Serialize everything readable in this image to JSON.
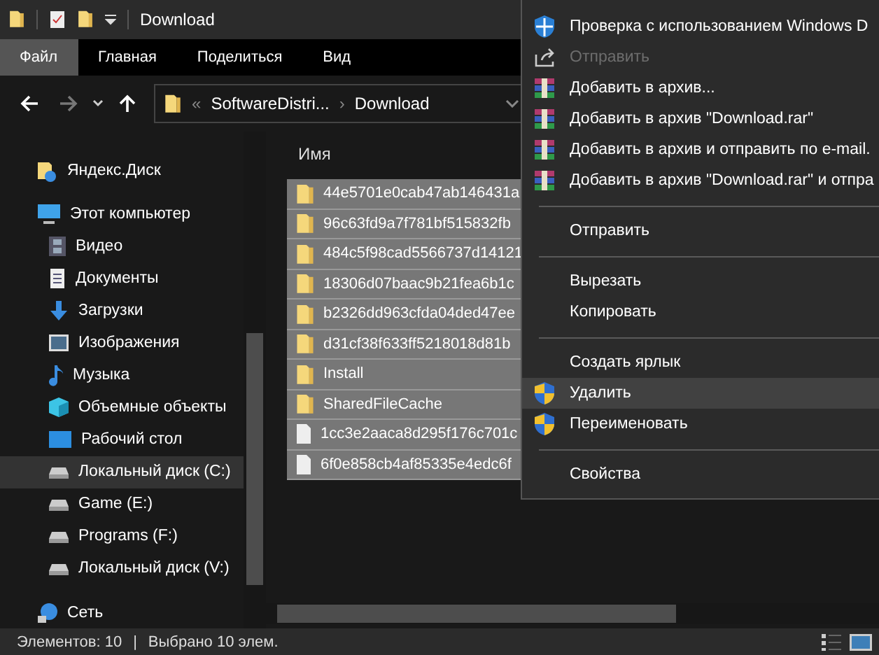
{
  "window": {
    "title": "Download"
  },
  "ribbon_tabs": [
    {
      "label": "Файл",
      "selected": true
    },
    {
      "label": "Главная",
      "selected": false
    },
    {
      "label": "Поделиться",
      "selected": false
    },
    {
      "label": "Вид",
      "selected": false
    }
  ],
  "address": {
    "prefix": "«",
    "crumbs": [
      "SoftwareDistri...",
      "Download"
    ],
    "separator": "›"
  },
  "sidebar": {
    "items": [
      {
        "label": "Яндекс.Диск",
        "kind": "cloud",
        "selected": false
      },
      {
        "label": "Этот компьютер",
        "kind": "computer",
        "selected": false,
        "children": [
          {
            "label": "Видео",
            "kind": "video",
            "selected": false
          },
          {
            "label": "Документы",
            "kind": "docs",
            "selected": false
          },
          {
            "label": "Загрузки",
            "kind": "download",
            "selected": false
          },
          {
            "label": "Изображения",
            "kind": "image",
            "selected": false
          },
          {
            "label": "Музыка",
            "kind": "music",
            "selected": false
          },
          {
            "label": "Объемные объекты",
            "kind": "cube",
            "selected": false
          },
          {
            "label": "Рабочий стол",
            "kind": "desktop",
            "selected": false
          },
          {
            "label": "Локальный диск (C:)",
            "kind": "drive",
            "selected": true
          },
          {
            "label": "Game (E:)",
            "kind": "drive",
            "selected": false
          },
          {
            "label": "Programs (F:)",
            "kind": "drive",
            "selected": false
          },
          {
            "label": "Локальный диск (V:)",
            "kind": "drive",
            "selected": false
          }
        ]
      },
      {
        "label": "Сеть",
        "kind": "network",
        "selected": false
      }
    ]
  },
  "file_list": {
    "column_header": "Имя",
    "rows": [
      {
        "name": "44e5701e0cab47ab146431a",
        "kind": "folder",
        "selected": true
      },
      {
        "name": "96c63fd9a7f781bf515832fb",
        "kind": "folder",
        "selected": true
      },
      {
        "name": "484c5f98cad5566737d14121",
        "kind": "folder",
        "selected": true
      },
      {
        "name": "18306d07baac9b21fea6b1c",
        "kind": "folder",
        "selected": true
      },
      {
        "name": "b2326dd963cfda04ded47ee",
        "kind": "folder",
        "selected": true
      },
      {
        "name": "d31cf38f633ff5218018d81b",
        "kind": "folder",
        "selected": true
      },
      {
        "name": "Install",
        "kind": "folder",
        "selected": true
      },
      {
        "name": "SharedFileCache",
        "kind": "folder",
        "selected": true
      },
      {
        "name": "1cc3e2aaca8d295f176c701c",
        "kind": "file",
        "selected": true
      },
      {
        "name": "6f0e858cb4af85335e4edc6f",
        "kind": "file",
        "selected": true
      }
    ]
  },
  "context_menu": [
    {
      "kind": "shield",
      "label": "Проверка с использованием Windows D",
      "disabled": false,
      "selected": false
    },
    {
      "kind": "share",
      "label": "Отправить",
      "disabled": true,
      "selected": false
    },
    {
      "kind": "archive",
      "label": "Добавить в архив...",
      "disabled": false,
      "selected": false
    },
    {
      "kind": "archive",
      "label": "Добавить в архив \"Download.rar\"",
      "disabled": false,
      "selected": false
    },
    {
      "kind": "archive",
      "label": "Добавить в архив и отправить по e-mail.",
      "disabled": false,
      "selected": false
    },
    {
      "kind": "archive",
      "label": "Добавить в архив \"Download.rar\" и отпра",
      "disabled": false,
      "selected": false
    },
    {
      "kind": "separator"
    },
    {
      "kind": "item",
      "label": "Отправить",
      "disabled": false,
      "selected": false
    },
    {
      "kind": "separator"
    },
    {
      "kind": "item",
      "label": "Вырезать",
      "disabled": false,
      "selected": false
    },
    {
      "kind": "item",
      "label": "Копировать",
      "disabled": false,
      "selected": false
    },
    {
      "kind": "separator"
    },
    {
      "kind": "item",
      "label": "Создать ярлык",
      "disabled": false,
      "selected": false
    },
    {
      "kind": "uac",
      "label": "Удалить",
      "disabled": false,
      "selected": true
    },
    {
      "kind": "uac",
      "label": "Переименовать",
      "disabled": false,
      "selected": false
    },
    {
      "kind": "separator"
    },
    {
      "kind": "item",
      "label": "Свойства",
      "disabled": false,
      "selected": false
    }
  ],
  "status_bar": {
    "count": "Элементов: 10",
    "divider": "|",
    "selection": "Выбрано 10 элем."
  }
}
